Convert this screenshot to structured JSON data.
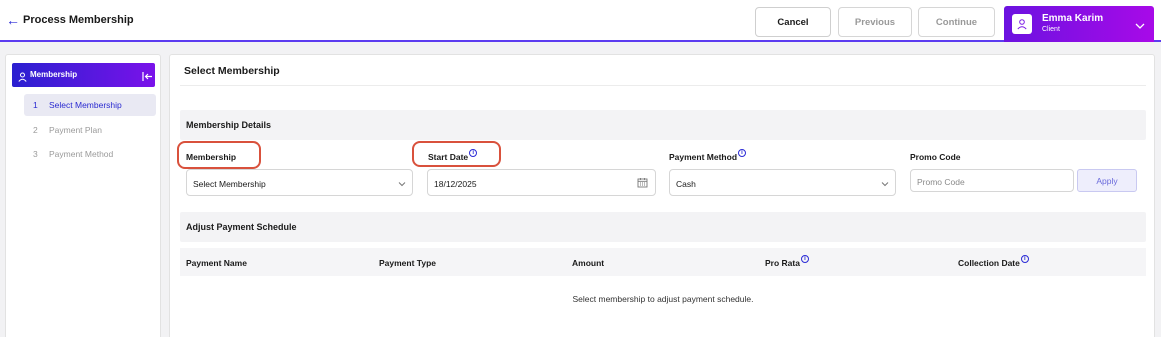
{
  "header": {
    "title": "Process Membership",
    "cancel_label": "Cancel",
    "previous_label": "Previous",
    "continue_label": "Continue",
    "user": {
      "name": "Emma Karim",
      "role": "Client"
    }
  },
  "sidebar": {
    "section_label": "Membership",
    "steps": [
      {
        "number": "1",
        "label": "Select Membership"
      },
      {
        "number": "2",
        "label": "Payment Plan"
      },
      {
        "number": "3",
        "label": "Payment Method"
      }
    ]
  },
  "main": {
    "title": "Select Membership",
    "details_heading": "Membership Details",
    "fields": {
      "membership_label": "Membership",
      "membership_value": "Select Membership",
      "start_date_label": "Start Date",
      "start_date_value": "18/12/2025",
      "payment_method_label": "Payment Method",
      "payment_method_value": "Cash",
      "promo_label": "Promo Code",
      "promo_placeholder": "Promo Code",
      "apply_label": "Apply"
    },
    "schedule_heading": "Adjust Payment Schedule",
    "columns": [
      "Payment Name",
      "Payment Type",
      "Amount",
      "Pro Rata",
      "Collection Date"
    ],
    "empty_message": "Select membership to adjust payment schedule."
  },
  "colors": {
    "accent": "#5b3cf0",
    "highlight_ring": "#d9513c"
  }
}
